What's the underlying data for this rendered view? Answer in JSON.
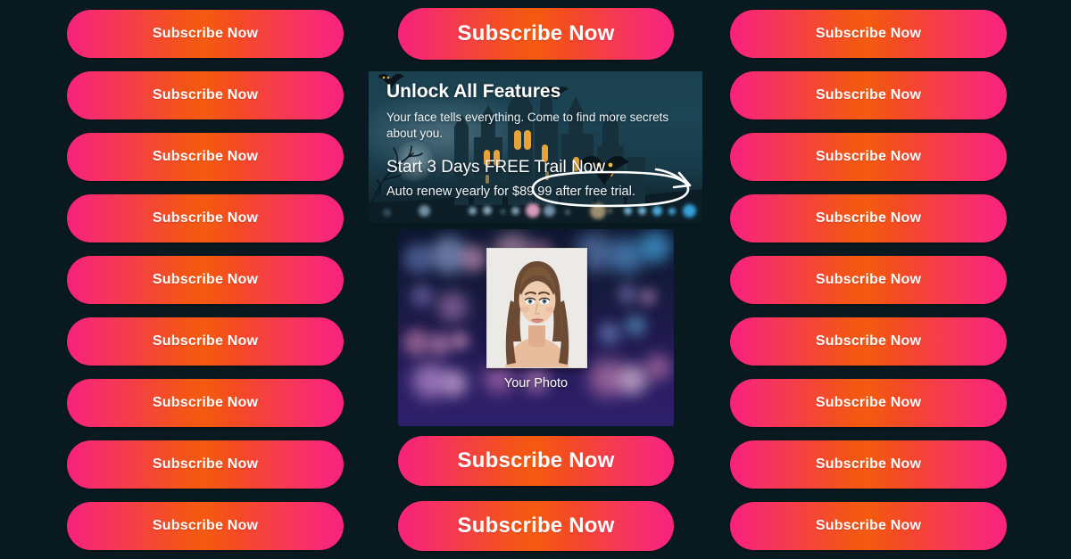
{
  "colors": {
    "background": "#08191f",
    "button_gradient_start": "#f8217a",
    "button_gradient_mid": "#f45410",
    "button_gradient_end": "#f9227d",
    "button_text": "#ffffff",
    "banner_sky": "#1c4454",
    "annotation_stroke": "#ffffff"
  },
  "buttons": {
    "label": "Subscribe Now",
    "left_column": [
      {
        "label": "Subscribe Now"
      },
      {
        "label": "Subscribe Now"
      },
      {
        "label": "Subscribe Now"
      },
      {
        "label": "Subscribe Now"
      },
      {
        "label": "Subscribe Now"
      },
      {
        "label": "Subscribe Now"
      },
      {
        "label": "Subscribe Now"
      },
      {
        "label": "Subscribe Now"
      },
      {
        "label": "Subscribe Now"
      }
    ],
    "right_column": [
      {
        "label": "Subscribe Now"
      },
      {
        "label": "Subscribe Now"
      },
      {
        "label": "Subscribe Now"
      },
      {
        "label": "Subscribe Now"
      },
      {
        "label": "Subscribe Now"
      },
      {
        "label": "Subscribe Now"
      },
      {
        "label": "Subscribe Now"
      },
      {
        "label": "Subscribe Now"
      },
      {
        "label": "Subscribe Now"
      }
    ],
    "center_column": [
      {
        "label": "Subscribe Now"
      },
      {
        "label": "Subscribe Now"
      },
      {
        "label": "Subscribe Now"
      }
    ]
  },
  "banner": {
    "title": "Unlock All Features",
    "subtitle": "Your face tells everything. Come to find more secrets about you.",
    "cta": "Start 3 Days FREE Trail Now",
    "fine_print": "Auto renew yearly for $89.99 after free trial.",
    "highlighted_price": "$89.99",
    "annotation": "hand-drawn-circle-with-arrow"
  },
  "photo_panel": {
    "caption": "Your Photo",
    "photo_alt": "portrait-headshot"
  }
}
